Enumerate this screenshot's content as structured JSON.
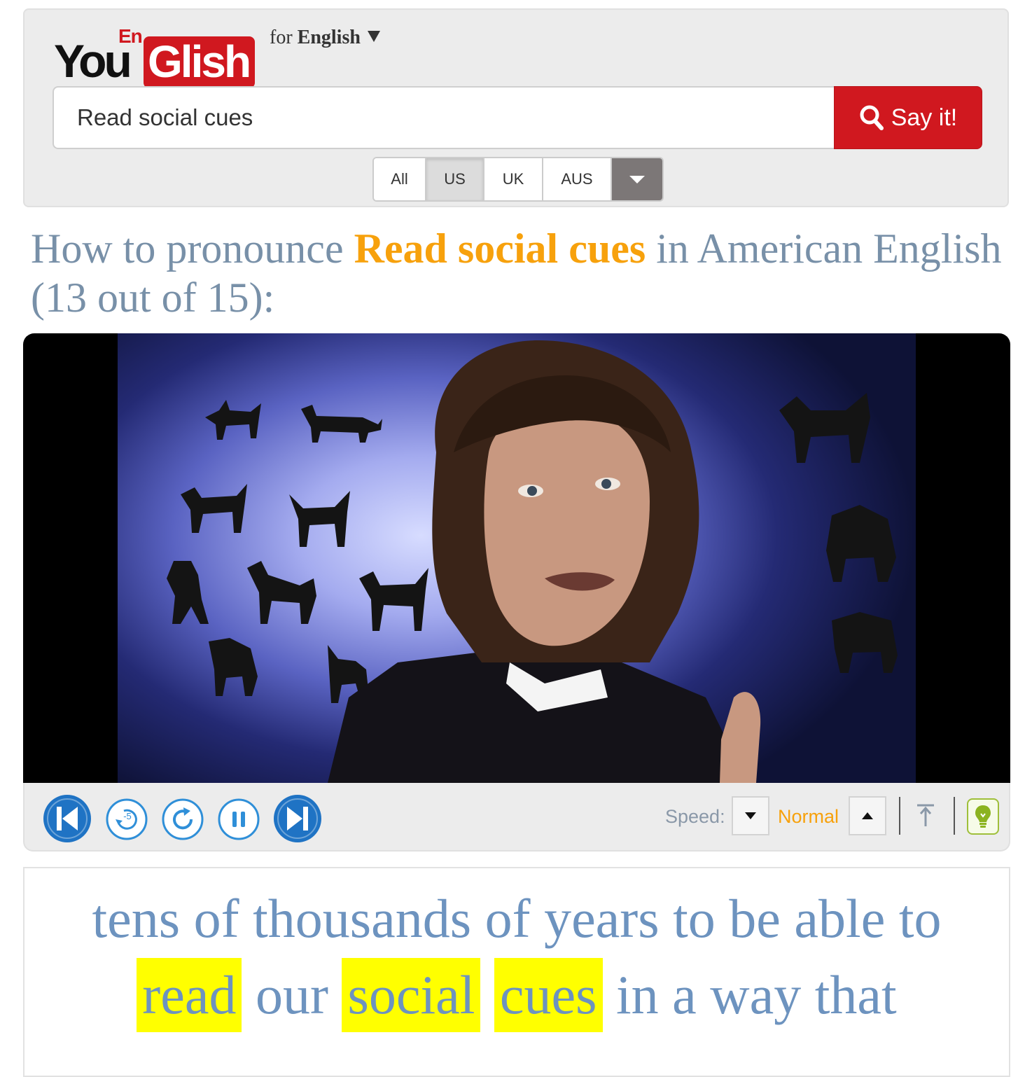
{
  "brand": {
    "you": "You",
    "en": "En",
    "glish": "Glish"
  },
  "language": {
    "prefix": "for",
    "name": "English"
  },
  "search": {
    "value": "Read social cues",
    "placeholder": "",
    "button_label": "Say it!"
  },
  "accents": [
    {
      "label": "All",
      "active": false
    },
    {
      "label": "US",
      "active": true
    },
    {
      "label": "UK",
      "active": false
    },
    {
      "label": "AUS",
      "active": false
    }
  ],
  "title": {
    "prefix": "How to pronounce",
    "phrase": "Read social cues",
    "suffix": "in American English (13 out of 15):"
  },
  "player": {
    "buttons": [
      "previous-icon",
      "replay-5-icon",
      "repeat-icon",
      "pause-icon",
      "next-icon"
    ],
    "speed_label": "Speed:",
    "speed_value": "Normal"
  },
  "caption": {
    "line1": "tens of thousands of years to be able to",
    "line2_words": [
      "read",
      "our",
      "social",
      "cues",
      "in a way that"
    ],
    "highlighted": [
      "read",
      "social",
      "cues"
    ]
  },
  "colors": {
    "brand_red": "#d0181f",
    "highlight_orange": "#f7a10c",
    "title_gray_blue": "#7890a8",
    "caption_blue": "#6d93bf",
    "caption_highlight": "#ffff00",
    "player_button_blue": "#1f73c4"
  }
}
